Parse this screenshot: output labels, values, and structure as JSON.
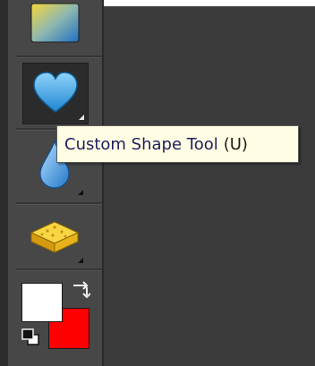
{
  "tooltip": {
    "name": "Custom Shape Tool",
    "shortcut": "(U)"
  },
  "tools": {
    "gradient": {
      "icon": "gradient-icon",
      "selected": false
    },
    "custom_shape": {
      "icon": "heart-icon",
      "selected": true
    },
    "blur": {
      "icon": "droplet-icon",
      "selected": false
    },
    "sponge": {
      "icon": "sponge-icon",
      "selected": false
    }
  },
  "colors": {
    "foreground": "#ffffff",
    "background": "#ff0000",
    "accent_heart": "#3aa7e3",
    "sponge": "#f4c21e"
  }
}
